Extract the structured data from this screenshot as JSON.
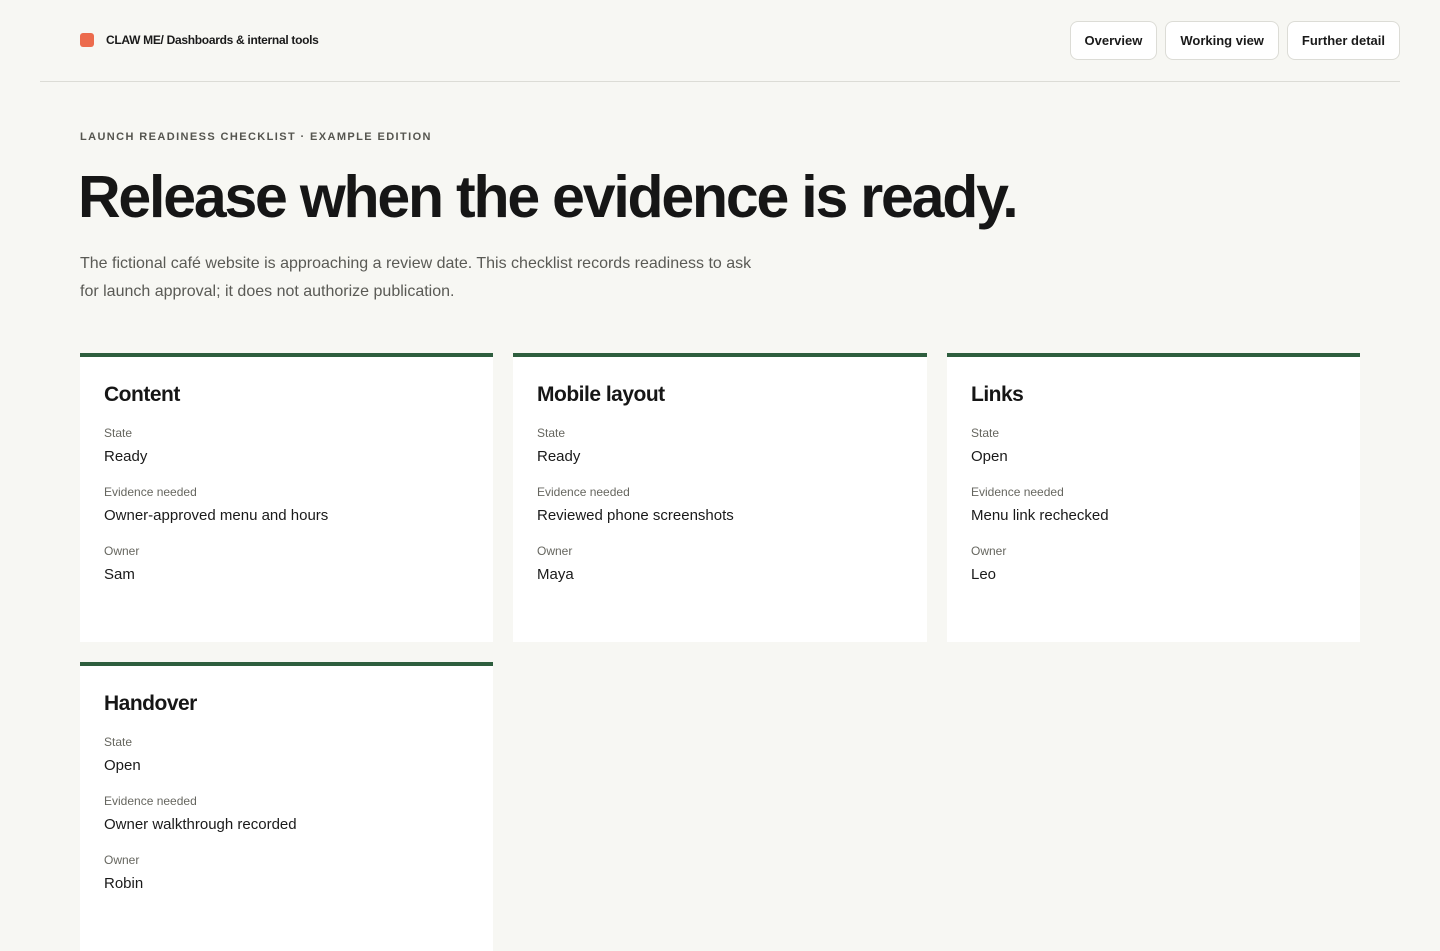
{
  "header": {
    "brand": "CLAW ME/ Dashboards & internal tools",
    "nav": [
      "Overview",
      "Working view",
      "Further detail"
    ]
  },
  "hero": {
    "eyebrow": "LAUNCH READINESS CHECKLIST · EXAMPLE EDITION",
    "title": "Release when the evidence is ready.",
    "description": "The fictional café website is approaching a review date. This checklist records readiness to ask for launch approval; it does not authorize publication."
  },
  "labels": {
    "state": "State",
    "evidence": "Evidence needed",
    "owner": "Owner"
  },
  "cards": [
    {
      "title": "Content",
      "state": "Ready",
      "evidence": "Owner-approved menu and hours",
      "owner": "Sam"
    },
    {
      "title": "Mobile layout",
      "state": "Ready",
      "evidence": "Reviewed phone screenshots",
      "owner": "Maya"
    },
    {
      "title": "Links",
      "state": "Open",
      "evidence": "Menu link rechecked",
      "owner": "Leo"
    },
    {
      "title": "Handover",
      "state": "Open",
      "evidence": "Owner walkthrough recorded",
      "owner": "Robin"
    }
  ],
  "colors": {
    "accent": "#2e5e3e",
    "brand_mark": "#ec6b4d",
    "background": "#f7f7f3"
  }
}
